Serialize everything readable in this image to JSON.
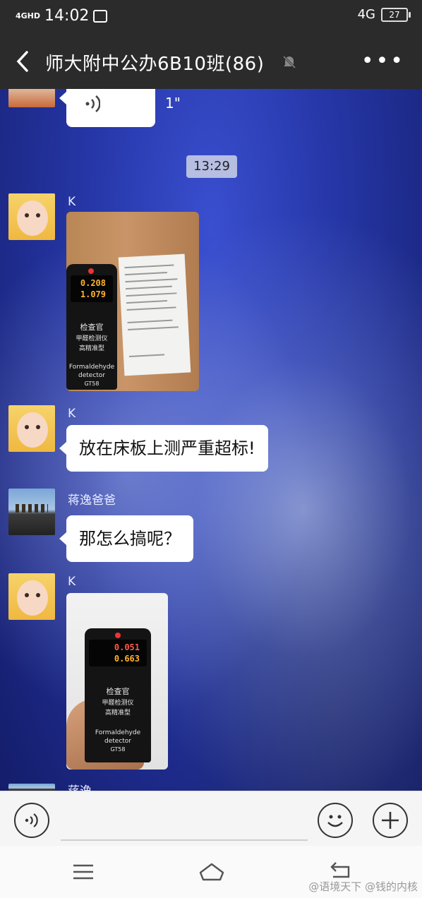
{
  "status_bar": {
    "signal": "4GHD",
    "time": "14:02",
    "network": "4G",
    "battery": "27"
  },
  "header": {
    "title": "师大附中公办6B10班(86)"
  },
  "chat": {
    "voice": {
      "duration": "1\""
    },
    "time_divider": "13:29",
    "messages": [
      {
        "sender": "K",
        "type": "image",
        "detector": {
          "reading1": "0.208",
          "reading2": "1.079",
          "line1": "检查官",
          "line2": "甲醛检测仪",
          "line3": "高精准型",
          "line4": "Formaldehyde",
          "line5": "detector",
          "line6": "GT58"
        }
      },
      {
        "sender": "K",
        "type": "text",
        "text": "放在床板上测严重超标!"
      },
      {
        "sender": "蒋逸爸爸",
        "type": "text",
        "text": "那怎么搞呢？"
      },
      {
        "sender": "K",
        "type": "image",
        "detector": {
          "reading1": "0.051",
          "reading2": "0.663",
          "line1": "检查官",
          "line2": "甲醛检测仪",
          "line3": "高精准型",
          "line4": "Formaldehyde",
          "line5": "detector",
          "line6": "GT58"
        }
      }
    ],
    "partial_sender": "蒋逸"
  },
  "input_bar": {
    "placeholder": ""
  },
  "watermark": "@语境天下 @钱的内核",
  "colors": {
    "header_bg": "#2b2b2b",
    "bubble_bg": "#ffffff",
    "chat_bg": "#2637a8"
  }
}
